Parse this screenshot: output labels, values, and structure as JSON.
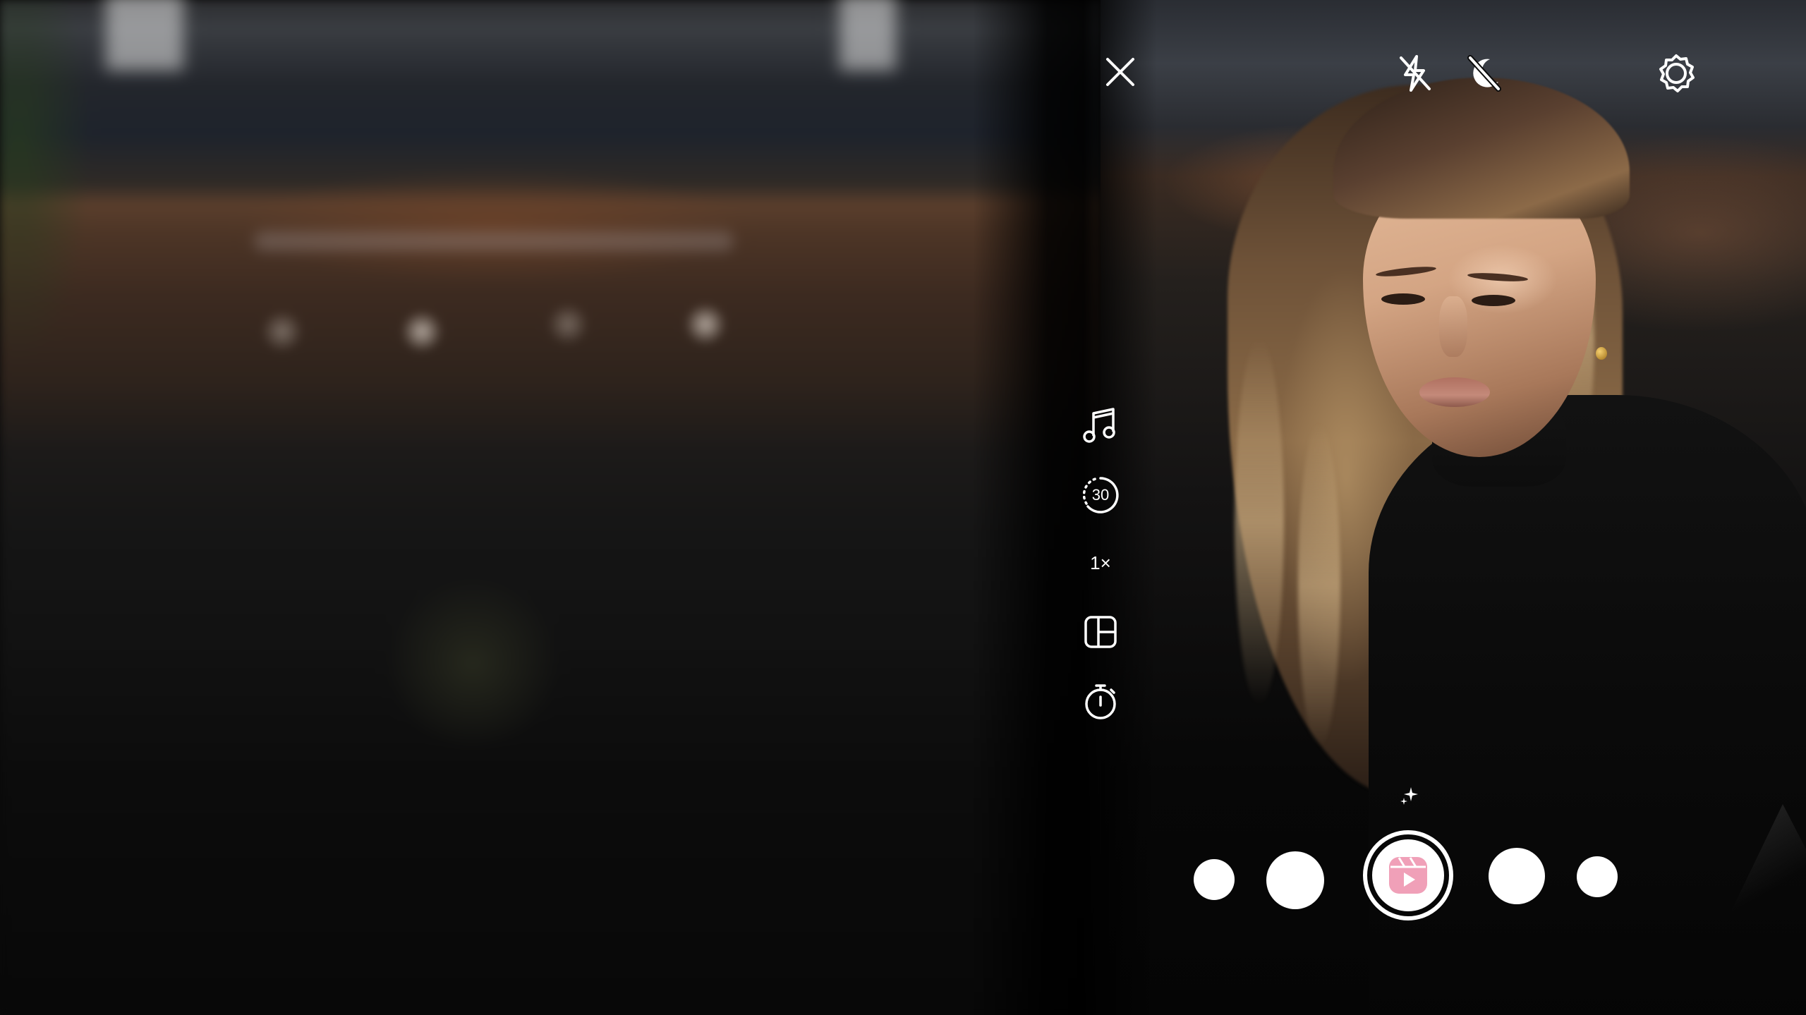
{
  "camera": {
    "mode": "reels",
    "accent_color": "#f0a0b8"
  },
  "top_bar": {
    "close_icon": "close-icon",
    "flash_icon": "flash-off-icon",
    "night_icon": "night-mode-off-icon",
    "settings_icon": "settings-gear-icon"
  },
  "side_tools": {
    "audio_icon": "music-note-icon",
    "length_label": "30",
    "speed_label": "1×",
    "layout_icon": "layout-icon",
    "timer_icon": "timer-icon"
  },
  "effects": {
    "sparkle_icon": "sparkle-icon",
    "shutter_icon": "reels-icon"
  }
}
